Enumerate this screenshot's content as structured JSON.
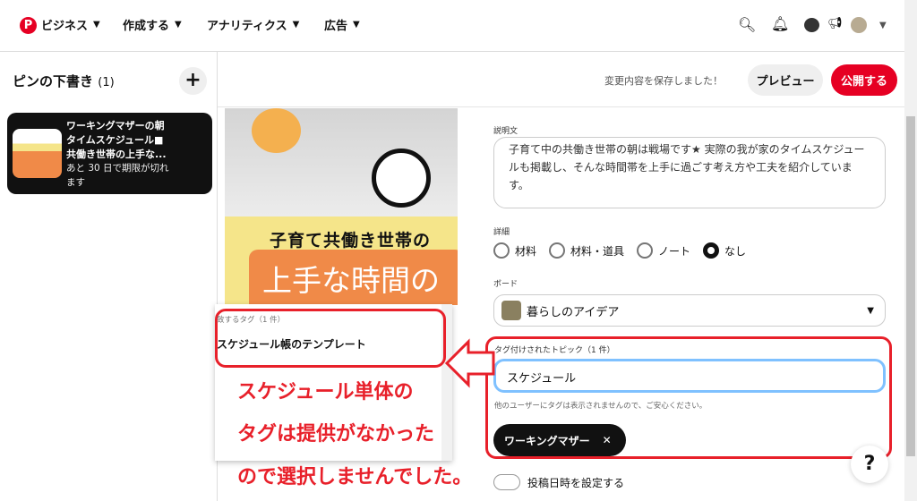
{
  "nav": {
    "items": [
      {
        "label": "ビジネス"
      },
      {
        "label": "作成する"
      },
      {
        "label": "アナリティクス"
      },
      {
        "label": "広告"
      }
    ],
    "icons": [
      "search-icon",
      "bell-icon",
      "chat-icon",
      "megaphone-icon",
      "avatar",
      "chevron-down-icon"
    ]
  },
  "sidebar": {
    "title": "ピンの下書き",
    "count": "(1)",
    "draft": {
      "title": "ワーキングマザーの朝タイムスケジュール■共働き世帯の上手な...",
      "expiry": "あと 30 日で期限が切れます"
    }
  },
  "topbar": {
    "status": "変更内容を保存しました！",
    "preview": "プレビュー",
    "publish": "公開する"
  },
  "pin_image": {
    "line1": "子育て共働き世帯の",
    "line2": "上手な時間の"
  },
  "form": {
    "description_label": "説明文",
    "description": "子育て中の共働き世帯の朝は戦場です★ 実際の我が家のタイムスケジュールも掲載し、そんな時間帯を上手に過ごす考え方や工夫を紹介しています。",
    "details_label": "詳細",
    "details_options": [
      "材料",
      "材料・道具",
      "ノート",
      "なし"
    ],
    "details_selected": "なし",
    "board_label": "ボード",
    "board_value": "暮らしのアイデア",
    "tags_label": "タグ付けされたトピック（1 件）",
    "tag_input": "スケジュール",
    "tags_hint": "他のユーザーにタグは表示されませんので、ご安心ください。",
    "tag_chip": "ワーキングマザー",
    "schedule_label": "投稿日時を設定する"
  },
  "suggest": {
    "header": "致するタグ（1 件）",
    "item": "スケジュール帳のテンプレート"
  },
  "annotation": {
    "line1": "スケジュール単体の",
    "line2": "タグは提供がなかった",
    "line3": "ので選択しませんでした。"
  },
  "help": "?",
  "colors": {
    "brand": "#e60023",
    "annotation": "#e8202a",
    "focus": "#7fc1ff"
  }
}
